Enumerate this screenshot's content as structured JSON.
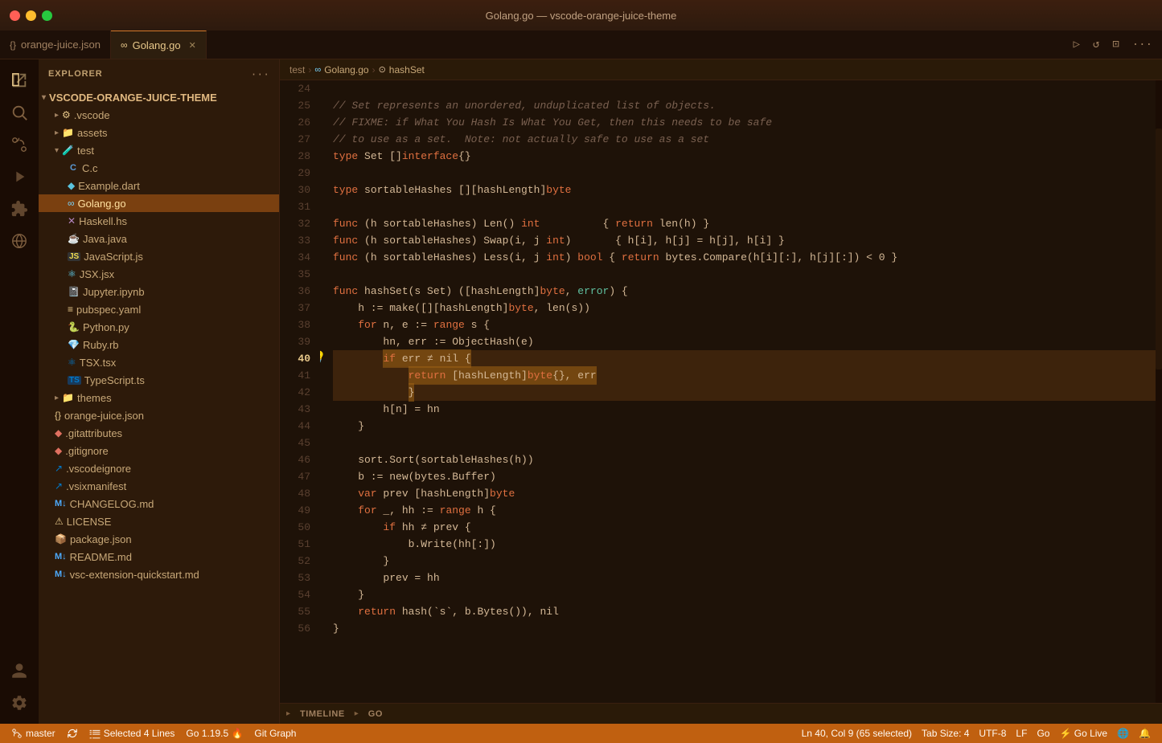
{
  "window": {
    "title": "Golang.go — vscode-orange-juice-theme",
    "controls": {
      "close": "●",
      "minimize": "●",
      "maximize": "●"
    }
  },
  "tabs": {
    "items": [
      {
        "id": "orange-juice-json",
        "label": "orange-juice.json",
        "icon": "{}",
        "active": false,
        "closable": false
      },
      {
        "id": "golang-go",
        "label": "Golang.go",
        "icon": "∞",
        "active": true,
        "closable": true
      }
    ],
    "actions": [
      "▷",
      "↺",
      "⊡",
      "···"
    ]
  },
  "breadcrumb": {
    "items": [
      "test",
      "Golang.go",
      "hashSet"
    ],
    "icons": [
      "folder",
      "go-file",
      "function"
    ]
  },
  "sidebar": {
    "title": "EXPLORER",
    "root": "VSCODE-ORANGE-JUICE-THEME",
    "files": [
      {
        "name": ".vscode",
        "type": "folder",
        "indent": 1,
        "icon": "🔧"
      },
      {
        "name": "assets",
        "type": "folder",
        "indent": 1,
        "icon": "📁"
      },
      {
        "name": "test",
        "type": "folder",
        "indent": 1,
        "icon": "🧪",
        "open": true
      },
      {
        "name": "C.c",
        "type": "file",
        "indent": 2,
        "icon": "C",
        "color": "#5b9ad5"
      },
      {
        "name": "Example.dart",
        "type": "file",
        "indent": 2,
        "icon": "◆",
        "color": "#5bc4df"
      },
      {
        "name": "Golang.go",
        "type": "file",
        "indent": 2,
        "icon": "∞",
        "color": "#79d4fd",
        "selected": true
      },
      {
        "name": "Haskell.hs",
        "type": "file",
        "indent": 2,
        "icon": "✕",
        "color": "#b284be"
      },
      {
        "name": "Java.java",
        "type": "file",
        "indent": 2,
        "icon": "☕",
        "color": "#e76f51"
      },
      {
        "name": "JavaScript.js",
        "type": "file",
        "indent": 2,
        "icon": "JS",
        "color": "#f0db4f"
      },
      {
        "name": "JSX.jsx",
        "type": "file",
        "indent": 2,
        "icon": "⚛",
        "color": "#61dafb"
      },
      {
        "name": "Jupyter.ipynb",
        "type": "file",
        "indent": 2,
        "icon": "📓",
        "color": "#f37726"
      },
      {
        "name": "pubspec.yaml",
        "type": "file",
        "indent": 2,
        "icon": "≡",
        "color": "#e8c88a"
      },
      {
        "name": "Python.py",
        "type": "file",
        "indent": 2,
        "icon": "🐍",
        "color": "#3572A5"
      },
      {
        "name": "Ruby.rb",
        "type": "file",
        "indent": 2,
        "icon": "💎",
        "color": "#cc342d"
      },
      {
        "name": "TSX.tsx",
        "type": "file",
        "indent": 2,
        "icon": "⚛",
        "color": "#007acc"
      },
      {
        "name": "TypeScript.ts",
        "type": "file",
        "indent": 2,
        "icon": "TS",
        "color": "#007acc"
      },
      {
        "name": "themes",
        "type": "folder",
        "indent": 1,
        "icon": "📁"
      },
      {
        "name": "orange-juice.json",
        "type": "file",
        "indent": 1,
        "icon": "{}",
        "color": "#e8c88a"
      },
      {
        "name": ".gitattributes",
        "type": "file",
        "indent": 1,
        "icon": "◆",
        "color": "#e07060"
      },
      {
        "name": ".gitignore",
        "type": "file",
        "indent": 1,
        "icon": "◆",
        "color": "#e07060"
      },
      {
        "name": ".vscodeignore",
        "type": "file",
        "indent": 1,
        "icon": "↗",
        "color": "#007acc"
      },
      {
        "name": ".vsixmanifest",
        "type": "file",
        "indent": 1,
        "icon": "↗",
        "color": "#007acc"
      },
      {
        "name": "CHANGELOG.md",
        "type": "file",
        "indent": 1,
        "icon": "M↓",
        "color": "#4daafc"
      },
      {
        "name": "LICENSE",
        "type": "file",
        "indent": 1,
        "icon": "⚠",
        "color": "#e8c88a"
      },
      {
        "name": "package.json",
        "type": "file",
        "indent": 1,
        "icon": "📦",
        "color": "#cb3837"
      },
      {
        "name": "README.md",
        "type": "file",
        "indent": 1,
        "icon": "M↓",
        "color": "#4daafc"
      },
      {
        "name": "vsc-extension-quickstart.md",
        "type": "file",
        "indent": 1,
        "icon": "M↓",
        "color": "#4daafc"
      }
    ]
  },
  "activity_bar": {
    "top_icons": [
      "files",
      "search",
      "source-control",
      "run-debug",
      "extensions",
      "remote"
    ],
    "bottom_icons": [
      "account",
      "settings"
    ]
  },
  "bottom_panels": [
    {
      "label": "TIMELINE"
    },
    {
      "label": "GO"
    }
  ],
  "status_bar": {
    "left": [
      {
        "icon": "branch",
        "text": "master"
      },
      {
        "icon": "sync",
        "text": ""
      },
      {
        "icon": "warning",
        "text": "Selected 4 Lines"
      },
      {
        "text": "Go 1.19.5 🔥"
      },
      {
        "text": "Git Graph"
      }
    ],
    "right": [
      {
        "text": "Ln 40, Col 9 (65 selected)"
      },
      {
        "text": "Tab Size: 4"
      },
      {
        "text": "UTF-8"
      },
      {
        "text": "LF"
      },
      {
        "text": "Go"
      },
      {
        "text": "⚡ Go Live"
      },
      {
        "text": "🌐"
      },
      {
        "text": "🔔"
      }
    ]
  },
  "code": {
    "lines": [
      {
        "num": 24,
        "content": ""
      },
      {
        "num": 25,
        "content": "    <cmt>// Set represents an unordered, unduplicated list of objects.</cmt>"
      },
      {
        "num": 26,
        "content": "    <cmt>// FIXME: if What You Hash Is What You Get, then this needs to be safe</cmt>"
      },
      {
        "num": 27,
        "content": "    <cmt>// to use as a set.  Note: not actually safe to use as a set</cmt>"
      },
      {
        "num": 28,
        "content": "    <kw>type</kw> Set []<kw>interface</kw>{}"
      },
      {
        "num": 29,
        "content": ""
      },
      {
        "num": 30,
        "content": "    <kw>type</kw> sortableHashes [][hashLength]<kw>byte</kw>"
      },
      {
        "num": 31,
        "content": ""
      },
      {
        "num": 32,
        "content": "    <kw>func</kw> (h sortableHashes) Len() <kw>int</kw>          { <kw>return</kw> len(h) }"
      },
      {
        "num": 33,
        "content": "    <kw>func</kw> (h sortableHashes) Swap(i, j <kw>int</kw>)       { h[i], h[j] = h[j], h[i] }"
      },
      {
        "num": 34,
        "content": "    <kw>func</kw> (h sortableHashes) Less(i, j <kw>int</kw>) <kw>bool</kw> { <kw>return</kw> bytes.Compare(h[i][:], h[j][:]) < 0 }"
      },
      {
        "num": 35,
        "content": ""
      },
      {
        "num": 36,
        "content": "    <kw>func</kw> hashSet(s Set) ([hashLength]<kw>byte</kw>, error) {"
      },
      {
        "num": 37,
        "content": "        h := make([][hashLength]<kw>byte</kw>, len(s))"
      },
      {
        "num": 38,
        "content": "        <kw>for</kw> n, e := <kw>range</kw> s {"
      },
      {
        "num": 39,
        "content": "            hn, err := ObjectHash(e)"
      },
      {
        "num": 40,
        "content": "            <sel>if err ≠ nil {</sel>",
        "highlighted": true,
        "gutter": "💡"
      },
      {
        "num": 41,
        "content": "                <sel>return [hashLength]byte{}, err</sel>",
        "highlighted": true
      },
      {
        "num": 42,
        "content": "            <sel>}</sel>",
        "highlighted": true
      },
      {
        "num": 43,
        "content": "            h[n] = hn"
      },
      {
        "num": 44,
        "content": "        }"
      },
      {
        "num": 45,
        "content": ""
      },
      {
        "num": 46,
        "content": "        sort.Sort(sortableHashes(h))"
      },
      {
        "num": 47,
        "content": "        b := new(bytes.Buffer)"
      },
      {
        "num": 48,
        "content": "        <kw>var</kw> prev [hashLength]<kw>byte</kw>"
      },
      {
        "num": 49,
        "content": "        <kw>for</kw> _, hh := <kw>range</kw> h {"
      },
      {
        "num": 50,
        "content": "            <kw>if</kw> hh ≠ prev {"
      },
      {
        "num": 51,
        "content": "                b.Write(hh[:])"
      },
      {
        "num": 52,
        "content": "            }"
      },
      {
        "num": 53,
        "content": "            prev = hh"
      },
      {
        "num": 54,
        "content": "        }"
      },
      {
        "num": 55,
        "content": "        <kw>return</kw> hash(`s`, b.Bytes()), nil"
      },
      {
        "num": 56,
        "content": "    }"
      }
    ]
  }
}
